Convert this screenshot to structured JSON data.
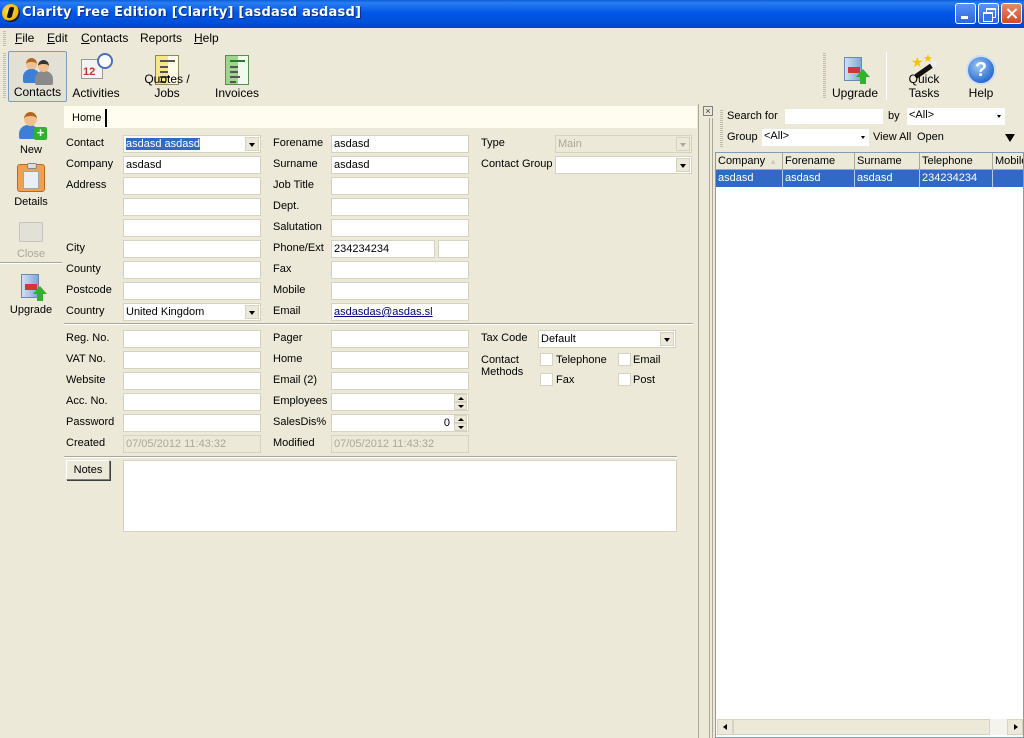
{
  "window": {
    "title": "Clarity Free Edition [Clarity] [asdasd asdasd]"
  },
  "menu": [
    {
      "label": "File",
      "accel": "F",
      "rest": "ile"
    },
    {
      "label": "Edit",
      "accel": "E",
      "rest": "dit"
    },
    {
      "label": "Contacts",
      "accel": "C",
      "rest": "ontacts"
    },
    {
      "label": "Reports",
      "accel": "",
      "rest": "Reports"
    },
    {
      "label": "Help",
      "accel": "H",
      "rest": "elp"
    }
  ],
  "toolbar": {
    "left": [
      {
        "label": "Contacts",
        "icon": "contacts-icon",
        "active": true
      },
      {
        "label": "Activities",
        "icon": "calendar-clock-icon"
      },
      {
        "label": "Quotes / Jobs",
        "icon": "quotes-document-icon"
      },
      {
        "label": "Invoices",
        "icon": "invoice-document-icon"
      }
    ],
    "right": [
      {
        "label": "Upgrade",
        "icon": "upgrade-icon"
      },
      {
        "label": "Quick Tasks",
        "icon": "magic-wand-icon"
      },
      {
        "label": "Help",
        "icon": "help-icon"
      }
    ]
  },
  "sidebar": [
    {
      "label": "New",
      "icon": "new-contact-icon",
      "enabled": true
    },
    {
      "label": "Details",
      "icon": "clipboard-icon",
      "enabled": true
    },
    {
      "label": "Close",
      "icon": "close-folder-icon",
      "enabled": false
    },
    {
      "label": "Upgrade",
      "icon": "upgrade-icon",
      "enabled": true
    }
  ],
  "tabs": [
    {
      "label": "Home"
    }
  ],
  "form": {
    "col1": {
      "contact": {
        "label": "Contact",
        "value": "asdasd asdasd"
      },
      "company": {
        "label": "Company",
        "value": "asdasd"
      },
      "address": {
        "label": "Address",
        "lines": [
          "",
          "",
          ""
        ]
      },
      "city": {
        "label": "City",
        "value": ""
      },
      "county": {
        "label": "County",
        "value": ""
      },
      "postcode": {
        "label": "Postcode",
        "value": ""
      },
      "country": {
        "label": "Country",
        "value": "United Kingdom"
      }
    },
    "col2": {
      "forename": {
        "label": "Forename",
        "value": "asdasd"
      },
      "surname": {
        "label": "Surname",
        "value": "asdasd"
      },
      "job_title": {
        "label": "Job Title",
        "value": ""
      },
      "dept": {
        "label": "Dept.",
        "value": ""
      },
      "salutation": {
        "label": "Salutation",
        "value": ""
      },
      "phone": {
        "label": "Phone/Ext",
        "value": "234234234",
        "ext": ""
      },
      "fax": {
        "label": "Fax",
        "value": ""
      },
      "mobile": {
        "label": "Mobile",
        "value": ""
      },
      "email": {
        "label": "Email",
        "value": "asdasdas@asdas.sl"
      }
    },
    "col3": {
      "type": {
        "label": "Type",
        "value": "Main"
      },
      "contact_group": {
        "label": "Contact Group",
        "value": ""
      }
    },
    "lower1": {
      "reg_no": {
        "label": "Reg. No.",
        "value": ""
      },
      "vat_no": {
        "label": "VAT No.",
        "value": ""
      },
      "website": {
        "label": "Website",
        "value": ""
      },
      "acc_no": {
        "label": "Acc. No.",
        "value": ""
      },
      "password": {
        "label": "Password",
        "value": ""
      },
      "created": {
        "label": "Created",
        "value": "07/05/2012 11:43:32"
      }
    },
    "lower2": {
      "pager": {
        "label": "Pager",
        "value": ""
      },
      "home": {
        "label": "Home",
        "value": ""
      },
      "email2": {
        "label": "Email (2)",
        "value": ""
      },
      "employees": {
        "label": "Employees",
        "value": ""
      },
      "salesdis": {
        "label": "SalesDis%",
        "value": "0"
      },
      "modified": {
        "label": "Modified",
        "value": "07/05/2012 11:43:32"
      }
    },
    "lower3": {
      "tax_code": {
        "label": "Tax Code",
        "value": "Default"
      },
      "contact_methods": {
        "label_line1": "Contact",
        "label_line2": "Methods",
        "options": [
          {
            "label": "Telephone",
            "checked": false
          },
          {
            "label": "Email",
            "checked": false
          },
          {
            "label": "Fax",
            "checked": false
          },
          {
            "label": "Post",
            "checked": false
          }
        ]
      }
    },
    "notes": {
      "button_label": "Notes",
      "value": ""
    }
  },
  "search_panel": {
    "close_glyph": "×",
    "search_label": "Search for",
    "search_value": "",
    "by_label": "by",
    "by_value": "<All>",
    "group_label": "Group",
    "group_value": "<All>",
    "view_all_label": "View All",
    "open_label": "Open",
    "columns": [
      "Company",
      "Forename",
      "Surname",
      "Telephone",
      "Mobile"
    ],
    "sort_glyph": "▲",
    "rows": [
      [
        "asdasd",
        "asdasd",
        "asdasd",
        "234234234",
        ""
      ]
    ]
  }
}
